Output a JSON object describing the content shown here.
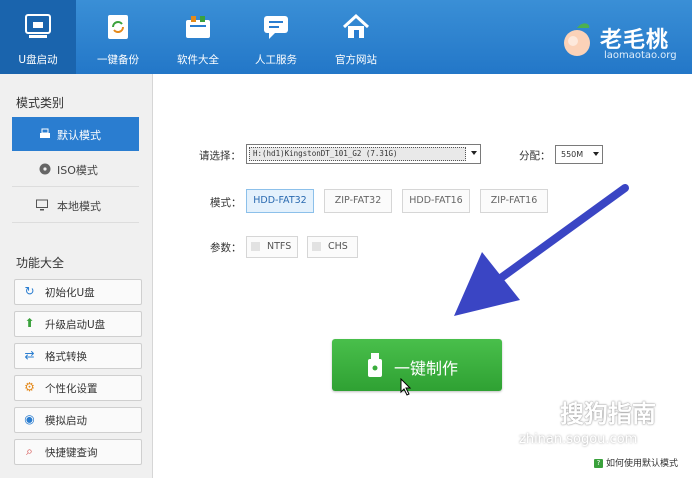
{
  "nav": [
    {
      "label": "U盘启动",
      "icon": "usb-monitor-icon",
      "active": true
    },
    {
      "label": "一键备份",
      "icon": "backup-icon",
      "active": false
    },
    {
      "label": "软件大全",
      "icon": "software-store-icon",
      "active": false
    },
    {
      "label": "人工服务",
      "icon": "chat-service-icon",
      "active": false
    },
    {
      "label": "官方网站",
      "icon": "home-icon",
      "active": false
    }
  ],
  "brand": {
    "name": "老毛桃",
    "url": "laomaotao.org",
    "icon": "peach-logo"
  },
  "sidebar": {
    "mode_title": "模式类别",
    "modes": [
      {
        "label": "默认模式",
        "icon": "usb-drive-icon",
        "active": true
      },
      {
        "label": "ISO模式",
        "icon": "disc-icon",
        "active": false
      },
      {
        "label": "本地模式",
        "icon": "monitor-icon",
        "active": false
      }
    ],
    "func_title": "功能大全",
    "functions": [
      {
        "label": "初始化U盘",
        "icon": "refresh-icon",
        "color": "#2a7dd0"
      },
      {
        "label": "升级启动U盘",
        "icon": "up-arrow-icon",
        "color": "#3aa13c"
      },
      {
        "label": "格式转换",
        "icon": "convert-icon",
        "color": "#2a7dd0"
      },
      {
        "label": "个性化设置",
        "icon": "gear-icon",
        "color": "#e48a1c"
      },
      {
        "label": "模拟启动",
        "icon": "eye-icon",
        "color": "#2a7dd0"
      },
      {
        "label": "快捷键查询",
        "icon": "search-icon",
        "color": "#d04040"
      }
    ]
  },
  "form": {
    "select_label": "请选择：",
    "drive_value": "H:(hd1)KingstonDT_101_G2 (7.31G)",
    "alloc_label": "分配：",
    "alloc_value": "550M",
    "mode_label": "模式：",
    "modes": [
      "HDD-FAT32",
      "ZIP-FAT32",
      "HDD-FAT16",
      "ZIP-FAT16"
    ],
    "selected_mode": "HDD-FAT32",
    "param_label": "参数：",
    "params": [
      "NTFS",
      "CHS"
    ],
    "make_label": "一键制作",
    "help_text": "如何使用默认模式"
  },
  "watermark": {
    "text": "搜狗指南",
    "url": "zhinan.sogou.com"
  },
  "colors": {
    "topbar": "#2b7fcd",
    "accent": "#2a7dd0",
    "make_button": "#3aad3c",
    "arrow": "#3a45c4"
  }
}
